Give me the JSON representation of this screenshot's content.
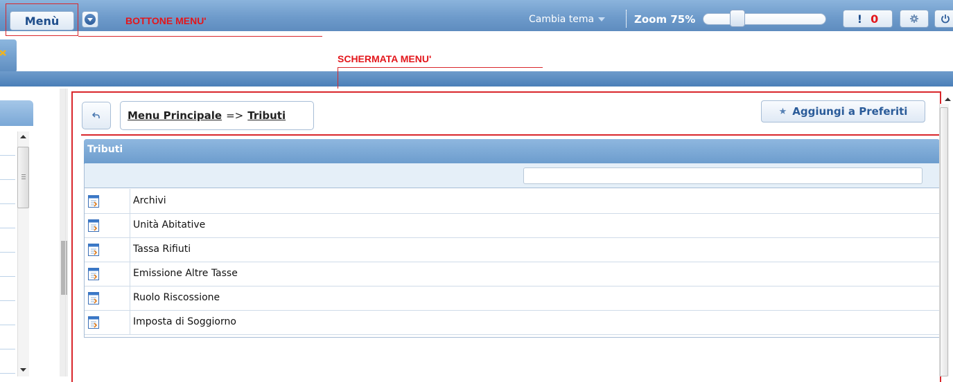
{
  "topbar": {
    "menu_label": "Menù",
    "annotation_button_menu": "BOTTONE MENU'",
    "theme_label": "Cambia tema",
    "zoom_label": "Zoom 75%",
    "zoom_level": 0.25,
    "alert_mark": "!",
    "alert_count": "0"
  },
  "annotation_menu_screen": "SCHERMATA MENU'",
  "breadcrumb": {
    "root": "Menu Principale",
    "separator": "=>",
    "current": "Tributi"
  },
  "favorites_label": "Aggiungi a Preferiti",
  "grid": {
    "title": "Tributi",
    "filter_value": "",
    "rows": [
      {
        "label": "Archivi"
      },
      {
        "label": "Unità Abitative"
      },
      {
        "label": "Tassa Rifiuti"
      },
      {
        "label": "Emissione Altre Tasse"
      },
      {
        "label": "Ruolo Riscossione"
      },
      {
        "label": "Imposta di Soggiorno"
      }
    ]
  },
  "colors": {
    "accent": "#6e9bcb",
    "annotation": "#d9262b",
    "alert": "#e3161b"
  },
  "icons": [
    "dropdown-circle-icon",
    "chevron-down-icon",
    "gear-icon",
    "power-icon",
    "back-arrow-icon",
    "star-icon",
    "document-icon"
  ]
}
